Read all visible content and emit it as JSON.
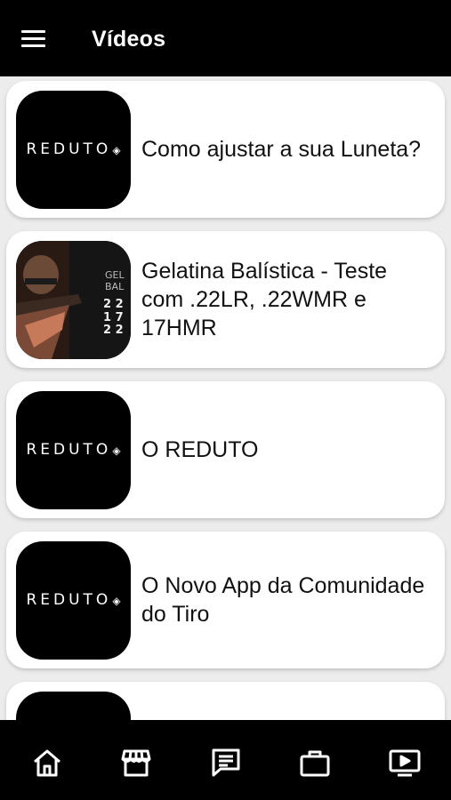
{
  "appbar": {
    "title": "Vídeos",
    "menu_icon": "menu-icon"
  },
  "videos": [
    {
      "title": "Como ajustar a sua Luneta?",
      "thumb": "reduto-logo"
    },
    {
      "title": "Gelatina Balística - Teste com .22LR, .22WMR e 17HMR",
      "thumb": "shooter-photo"
    },
    {
      "title": "O REDUTO",
      "thumb": "reduto-logo"
    },
    {
      "title": "O Novo App da Comunidade do Tiro",
      "thumb": "reduto-logo"
    }
  ],
  "logo_text": "REDUTO",
  "bottom_nav": [
    {
      "icon": "home-icon"
    },
    {
      "icon": "store-icon"
    },
    {
      "icon": "chat-icon"
    },
    {
      "icon": "briefcase-icon"
    },
    {
      "icon": "video-icon"
    }
  ],
  "colors": {
    "bar": "#000000",
    "background": "#ececec",
    "card": "#ffffff"
  }
}
